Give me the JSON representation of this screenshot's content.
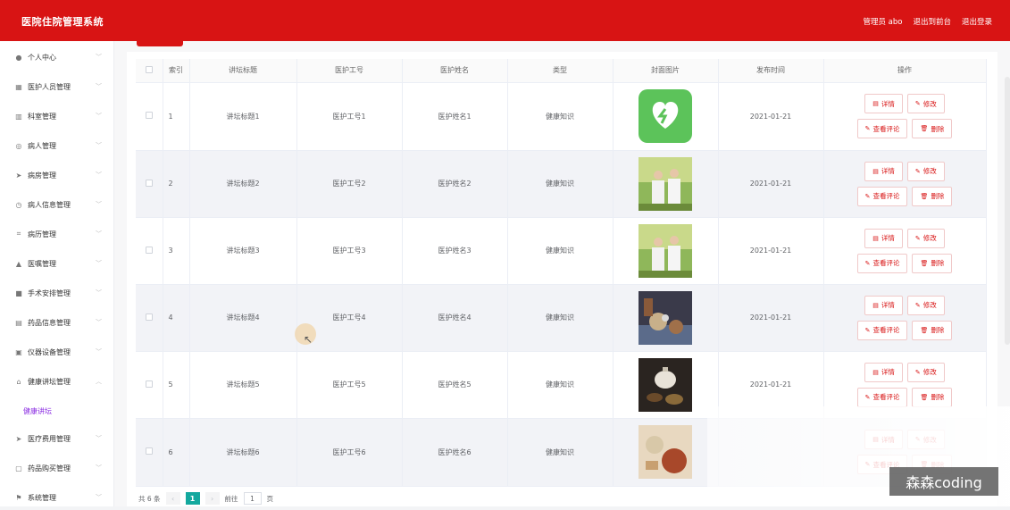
{
  "header": {
    "title": "医院住院管理系统",
    "admin": "管理员 abo",
    "back": "退出到前台",
    "logout": "退出登录"
  },
  "sidebar": {
    "items": [
      {
        "label": "个人中心",
        "icon": "user-icon"
      },
      {
        "label": "医护人员管理",
        "icon": "grid-icon"
      },
      {
        "label": "科室管理",
        "icon": "chart-icon"
      },
      {
        "label": "病人管理",
        "icon": "compass-icon"
      },
      {
        "label": "病房管理",
        "icon": "send-icon"
      },
      {
        "label": "病人信息管理",
        "icon": "clock-icon"
      },
      {
        "label": "病历管理",
        "icon": "crop-icon"
      },
      {
        "label": "医嘱管理",
        "icon": "person-icon"
      },
      {
        "label": "手术安排管理",
        "icon": "doc-icon"
      },
      {
        "label": "药品信息管理",
        "icon": "drug-icon"
      },
      {
        "label": "仪器设备管理",
        "icon": "device-icon"
      },
      {
        "label": "健康讲坛管理",
        "icon": "home-icon"
      },
      {
        "label": "医疗费用管理",
        "icon": "send-icon"
      },
      {
        "label": "药品购买管理",
        "icon": "chat-icon"
      },
      {
        "label": "系统管理",
        "icon": "flag-icon"
      }
    ],
    "submenu": "健康讲坛"
  },
  "table": {
    "headers": [
      "",
      "索引",
      "讲坛标题",
      "医护工号",
      "医护姓名",
      "类型",
      "封面图片",
      "发布时间",
      "操作"
    ],
    "rows": [
      {
        "index": "1",
        "title": "讲坛标题1",
        "staff_id": "医护工号1",
        "staff_name": "医护姓名1",
        "type": "健康知识",
        "date": "2021-01-21",
        "image": "heart-app-icon"
      },
      {
        "index": "2",
        "title": "讲坛标题2",
        "staff_id": "医护工号2",
        "staff_name": "医护姓名2",
        "type": "健康知识",
        "date": "2021-01-21",
        "image": "elderly-couple-photo"
      },
      {
        "index": "3",
        "title": "讲坛标题3",
        "staff_id": "医护工号3",
        "staff_name": "医护姓名3",
        "type": "健康知识",
        "date": "2021-01-21",
        "image": "elderly-couple-photo"
      },
      {
        "index": "4",
        "title": "讲坛标题4",
        "staff_id": "医护工号4",
        "staff_name": "医护姓名4",
        "type": "健康知识",
        "date": "2021-01-21",
        "image": "food-table-photo"
      },
      {
        "index": "5",
        "title": "讲坛标题5",
        "staff_id": "医护工号5",
        "staff_name": "医护姓名5",
        "type": "健康知识",
        "date": "2021-01-21",
        "image": "tea-pot-photo"
      },
      {
        "index": "6",
        "title": "讲坛标题6",
        "staff_id": "医护工号6",
        "staff_name": "医护姓名6",
        "type": "健康知识",
        "date": "",
        "image": "roast-food-photo"
      }
    ],
    "actions": {
      "detail": "详情",
      "edit": "修改",
      "comments": "查看评论",
      "delete": "删除"
    }
  },
  "pagination": {
    "total": "共 6 条",
    "current": "1",
    "goto": "前往",
    "goto_value": "1",
    "page_suffix": "页"
  },
  "watermark": "森森coding",
  "colors": {
    "brand": "#d81414",
    "pager_active": "#13a89e",
    "submenu": "#8a2be2"
  }
}
